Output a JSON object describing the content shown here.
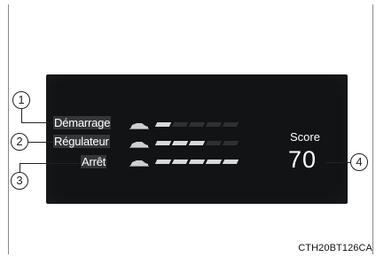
{
  "rows": [
    {
      "label": "Démarrage",
      "filled": 1,
      "total": 5
    },
    {
      "label": "Régulateur",
      "filled": 3,
      "total": 5
    },
    {
      "label": "Arrêt",
      "filled": 5,
      "total": 5
    }
  ],
  "score": {
    "label": "Score",
    "value": "70"
  },
  "callouts": [
    "1",
    "2",
    "3",
    "4"
  ],
  "caption": "CTH20BT126CA",
  "colors": {
    "panel": "#111315",
    "segment_on": "#d8d8d8",
    "segment_off": "#2d3133",
    "label_bg": "#333738"
  },
  "icons": [
    "car-start-icon",
    "car-cruise-icon",
    "car-stop-icon"
  ]
}
